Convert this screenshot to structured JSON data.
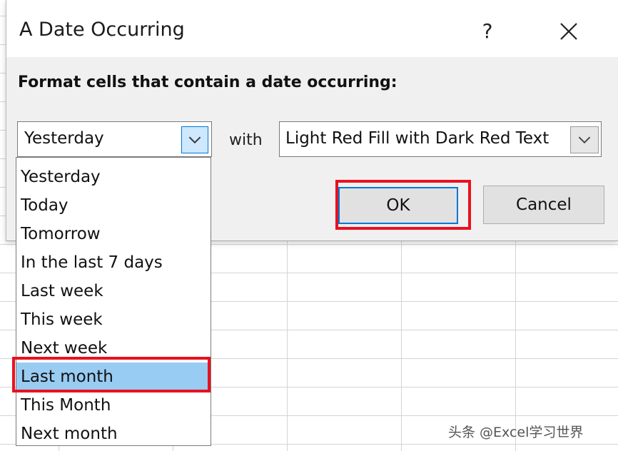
{
  "dialog": {
    "title": "A Date Occurring",
    "help_label": "?",
    "prompt": "Format cells that contain a date occurring:",
    "date_select": {
      "value": "Yesterday"
    },
    "with_label": "with",
    "style_select": {
      "value": "Light Red Fill with Dark Red Text"
    },
    "ok_label": "OK",
    "cancel_label": "Cancel"
  },
  "dropdown": {
    "options": [
      "Yesterday",
      "Today",
      "Tomorrow",
      "In the last 7 days",
      "Last week",
      "This week",
      "Next week",
      "Last month",
      "This Month",
      "Next month"
    ],
    "highlighted": "Last month"
  },
  "annotation_color": "#e8111f",
  "watermark": "头条 @Excel学习世界"
}
